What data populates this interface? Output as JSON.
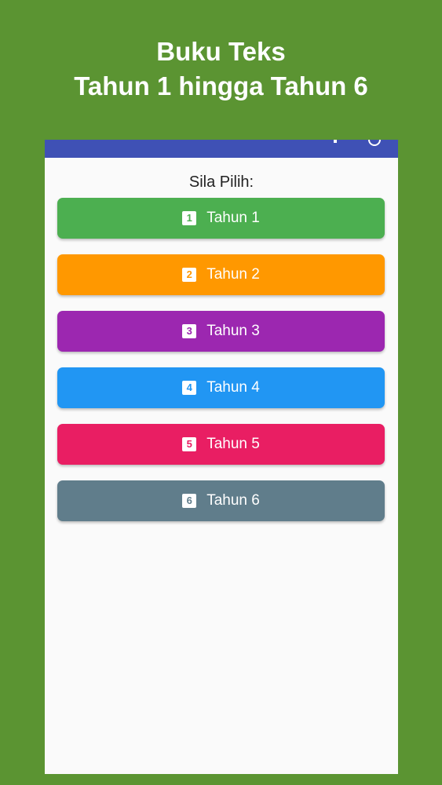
{
  "promo": {
    "title_line1": "Buku Teks",
    "title_line2": "Tahun 1 hingga Tahun 6"
  },
  "screen": {
    "prompt": "Sila Pilih:",
    "buttons": [
      {
        "label": "Tahun 1",
        "badge": "1",
        "color": "#4caf50"
      },
      {
        "label": "Tahun 2",
        "badge": "2",
        "color": "#ff9800"
      },
      {
        "label": "Tahun 3",
        "badge": "3",
        "color": "#9c27b0"
      },
      {
        "label": "Tahun 4",
        "badge": "4",
        "color": "#2196f3"
      },
      {
        "label": "Tahun 5",
        "badge": "5",
        "color": "#e91e63"
      },
      {
        "label": "Tahun 6",
        "badge": "6",
        "color": "#607d8b"
      }
    ]
  },
  "colors": {
    "background": "#5b9432",
    "app_bar": "#3f51b5",
    "screen": "#fafafa"
  }
}
